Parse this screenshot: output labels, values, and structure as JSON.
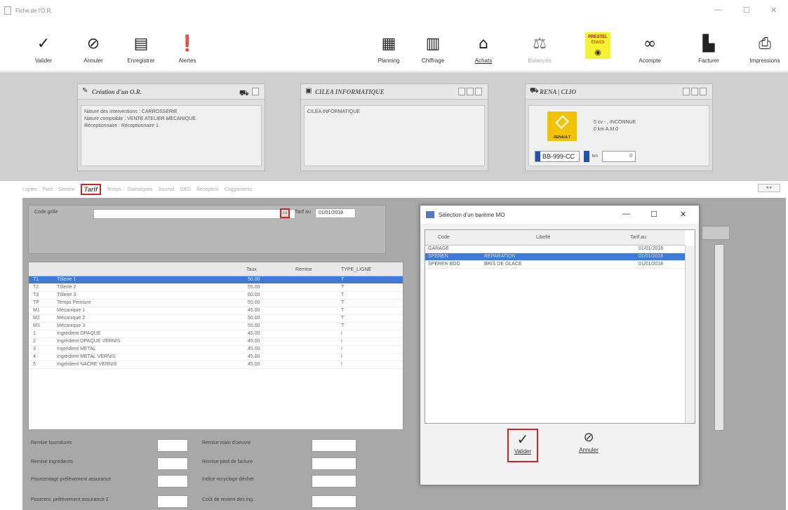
{
  "window": {
    "title": "Fiche de l'O.R.",
    "minimize": "—",
    "maximize": "☐",
    "close": "✕"
  },
  "toolbar": {
    "left": [
      {
        "label": "Valider",
        "icon": "✓",
        "name": "valider-button",
        "icon_name": "check-icon"
      },
      {
        "label": "Annuler",
        "icon": "⊘",
        "name": "annuler-button",
        "icon_name": "cancel-icon"
      },
      {
        "label": "Enregistrer",
        "icon": "▤",
        "name": "enregistrer-button",
        "icon_name": "save-icon"
      },
      {
        "label": "Alertes",
        "icon": "❗",
        "name": "alertes-button",
        "icon_name": "alert-icon"
      }
    ],
    "right": [
      {
        "label": "Planning",
        "icon": "▦",
        "name": "planning-button",
        "icon_name": "calendar-icon"
      },
      {
        "label": "Chiffrage",
        "icon": "▥",
        "name": "chiffrage-button",
        "icon_name": "calculator-icon"
      },
      {
        "label": "Achats",
        "icon": "⌂",
        "name": "achats-button",
        "icon_name": "shop-icon"
      },
      {
        "label": "Balances",
        "icon": "⚖",
        "name": "balances-button",
        "icon_name": "balance-icon"
      },
      {
        "label": "ENVOI",
        "icon": "◉",
        "name": "prestel-envoi-button",
        "icon_name": "prestel-icon",
        "brand": "PRESTEL"
      },
      {
        "label": "Acompte",
        "icon": "∞",
        "name": "acompte-button",
        "icon_name": "coins-icon"
      },
      {
        "label": "Facturer",
        "icon": "▙",
        "name": "facturer-button",
        "icon_name": "invoice-icon"
      },
      {
        "label": "Impressions",
        "icon": "⎙",
        "name": "impressions-button",
        "icon_name": "printer-icon"
      }
    ]
  },
  "cards": {
    "or": {
      "title": "Création d'un O.R.",
      "lines": [
        "Nature des interventions : CARROSSERIE",
        "Nature comptable : VENTE ATELIER MECANIQUE",
        "Réceptionnaire : Réceptionnaire 1"
      ]
    },
    "client": {
      "title": "CILEA INFORMATIQUE",
      "lines": [
        "CILEA INFORMATIQUE"
      ]
    },
    "vehicle": {
      "title": "RENA | CLIO",
      "brand": "RENAULT",
      "line1": "0 cv - , INCONNUE",
      "line2": "0 km A.M.0",
      "plate": "BB-999-CC",
      "km_label": "km",
      "km_value": "0"
    }
  },
  "tabs": [
    "Lignes",
    "Pied",
    "Sinistre",
    "Tarif",
    "Temps",
    "Statistiques",
    "Journal",
    "GED",
    "Réception",
    "Coggaments"
  ],
  "active_tab": "Tarif",
  "tarif": {
    "code_grille_label": "Code grille",
    "code_grille_value": "",
    "tarif_au_label": "Tarif au",
    "tarif_au_value": "01/01/2018"
  },
  "rates_table": {
    "headers": [
      "",
      "",
      "Taux",
      "Remise",
      "TYPE_LIGNE"
    ],
    "rows": [
      [
        "T1",
        "Tôlerie 1",
        "50.00",
        "",
        "T"
      ],
      [
        "T2",
        "Tôlerie 2",
        "55.00",
        "",
        "T"
      ],
      [
        "T3",
        "Tôlerie 3",
        "60.00",
        "",
        "T"
      ],
      [
        "TP",
        "Temps Peinture",
        "55.00",
        "",
        "T"
      ],
      [
        "M1",
        "Mécanique 1",
        "45.00",
        "",
        "T"
      ],
      [
        "M2",
        "Mécanique 2",
        "50.00",
        "",
        "T"
      ],
      [
        "M3",
        "Mécanique 3",
        "55.00",
        "",
        "T"
      ],
      [
        "1",
        "Ingrédient OPAQUE",
        "45.00",
        "",
        "I"
      ],
      [
        "2",
        "Ingrédient OPAQUE VERNIS",
        "45.00",
        "",
        "I"
      ],
      [
        "3",
        "Ingrédient METAL",
        "45.00",
        "",
        "I"
      ],
      [
        "4",
        "Ingrédient METAL VERNIS",
        "45.00",
        "",
        "I"
      ],
      [
        "5",
        "Ingrédient NACRE VERNIS",
        "45.00",
        "",
        "I"
      ]
    ]
  },
  "bottom_fields": {
    "left": [
      "Remise fournitures",
      "Remise ingrédients",
      "Pourcentage prélèvement assurance",
      "Pourcent. prélèvement assurance 2"
    ],
    "right": [
      "Remise main d'oeuvre",
      "Remise pied de facture",
      "Indice recyclage déchet",
      "Coût de revient des ing."
    ]
  },
  "dialog": {
    "title": "Sélection d'un barème MO",
    "headers": [
      "Code",
      "Libellé",
      "Tarif au"
    ],
    "rows": [
      [
        "GARAGE",
        "",
        "01/01/2018"
      ],
      [
        "SPEREN",
        "REPARATION",
        "01/01/2018"
      ],
      [
        "SPEREN BDG",
        "BRIS DE GLACE",
        "01/01/2018"
      ]
    ],
    "ok_label": "Valider",
    "cancel_label": "Annuler"
  },
  "colors": {
    "selection": "#3d7bd6",
    "highlight": "#d32424",
    "panel": "#a8a8a8"
  }
}
